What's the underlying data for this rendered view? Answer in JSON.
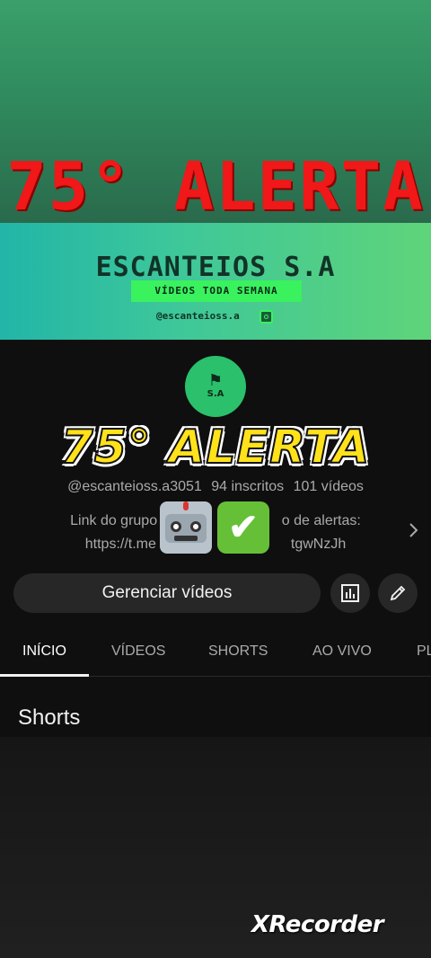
{
  "video_overlay": {
    "top_alert_text": "75° ALERTA",
    "overlay_alert_text": "75° ALERTA",
    "watermark": "XRecorder"
  },
  "banner": {
    "title": "ESCANTEIOS S.A",
    "tagline": "VÍDEOS TODA SEMANA",
    "handle": "@escanteioss.a",
    "social_icon": "instagram-icon"
  },
  "channel": {
    "avatar_text": "S.A",
    "handle": "@escanteioss.a3051",
    "subscribers": "94 inscritos",
    "videos": "101 vídeos",
    "description_line1": "Link do grupo gratuito de alerta de alertas:",
    "description_visible_line1_left": "Link do grupo gr",
    "description_visible_line1_right": "o de alertas:",
    "description_visible_line2_left": "https://t.me",
    "description_visible_line2_right": "tgwNzJh",
    "emojis": [
      "robot-emoji",
      "check-mark-emoji"
    ]
  },
  "actions": {
    "manage_label": "Gerenciar vídeos",
    "analytics_icon": "analytics-icon",
    "edit_icon": "pencil-icon"
  },
  "tabs": [
    {
      "label": "INÍCIO",
      "active": true
    },
    {
      "label": "VÍDEOS",
      "active": false
    },
    {
      "label": "SHORTS",
      "active": false
    },
    {
      "label": "AO VIVO",
      "active": false
    },
    {
      "label": "PL",
      "active": false
    }
  ],
  "content": {
    "section_title": "Shorts"
  },
  "colors": {
    "alert_red": "#f01818",
    "overlay_yellow": "#ffe21a",
    "banner_green": "#39f25e",
    "background": "#0f0f0f"
  }
}
